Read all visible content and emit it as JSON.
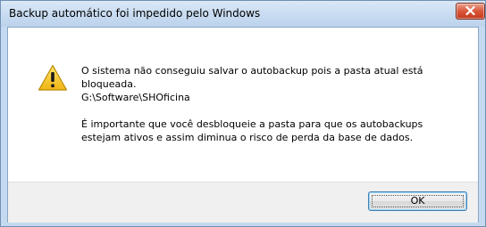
{
  "window": {
    "title": "Backup automático foi impedido pelo Windows",
    "close_icon": "close-icon"
  },
  "message": {
    "icon": "warning-icon",
    "line1": "O sistema não conseguiu salvar o autobackup pois a pasta atual está",
    "line2": "bloqueada.",
    "path": "G:\\Software\\SHOficina",
    "line4": "É importante que você desbloqueie a pasta para que os autobackups",
    "line5": "estejam ativos e assim diminua o risco de perda da base de dados."
  },
  "buttons": {
    "ok_label": "OK"
  },
  "colors": {
    "close_button": "#c7391f",
    "warning_icon": "#f4c21b",
    "default_button_border": "#3c7fb1"
  }
}
